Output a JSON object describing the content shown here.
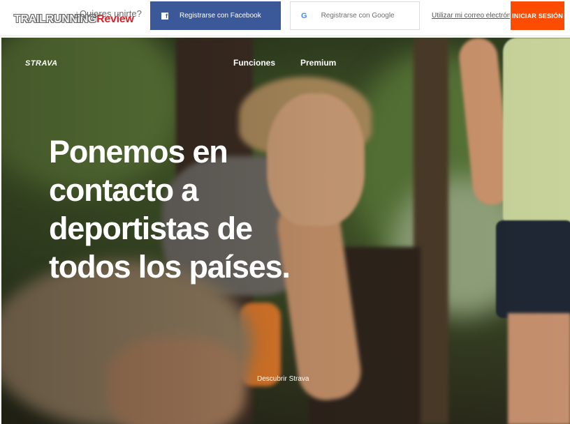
{
  "watermark": {
    "part1": "TRAILRUNNING",
    "part2": "Review"
  },
  "signup_bar": {
    "prompt": "¿Quieres unirte?",
    "facebook_label": "Registrarse con Facebook",
    "facebook_icon": "facebook-icon",
    "google_label": "Registrarse con Google",
    "google_icon": "google-icon",
    "email_link": "Utilizar mi correo electrónico",
    "login_label": "INICIAR SESIÓN"
  },
  "colors": {
    "facebook": "#3b5998",
    "login": "#fc4c02"
  },
  "hero": {
    "logo": "STRAVA",
    "nav": [
      "Funciones",
      "Premium"
    ],
    "headline": "Ponemos en contacto a deportistas de todos los países.",
    "discover": "Descubrir Strava"
  }
}
